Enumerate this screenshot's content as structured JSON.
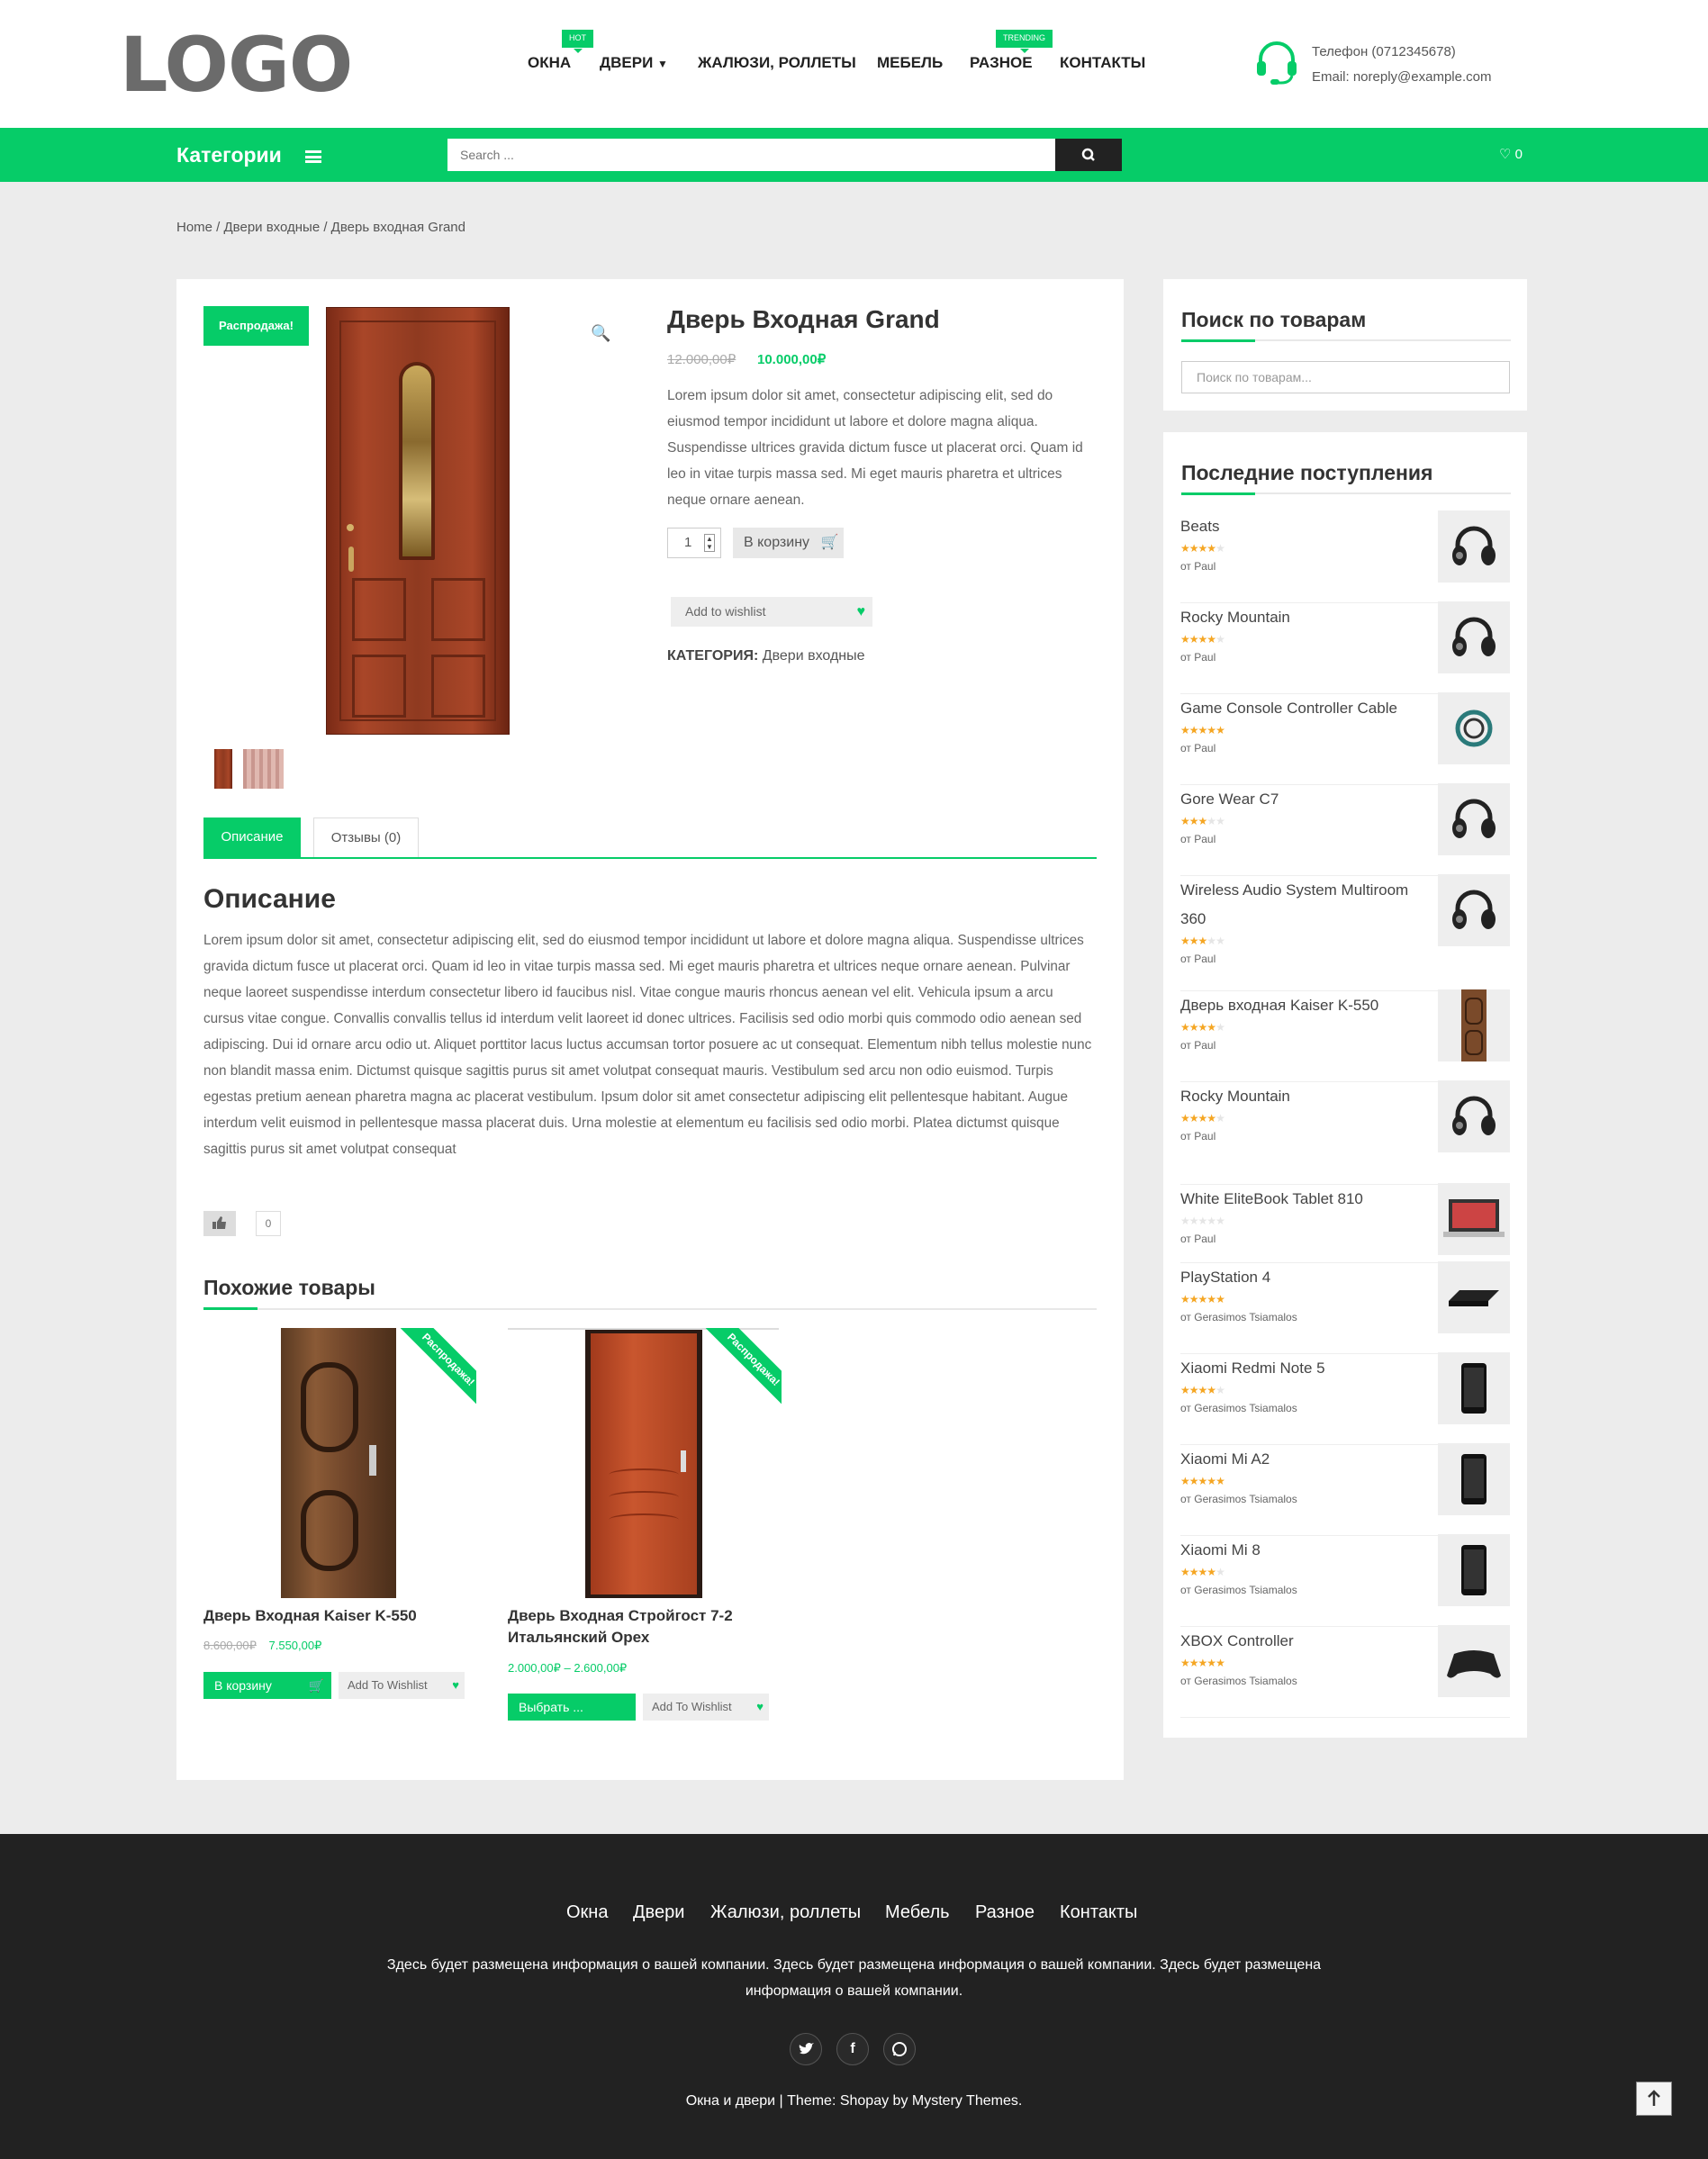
{
  "header": {
    "logo": "LOGO",
    "nav": [
      {
        "label": "ОКНА"
      },
      {
        "label": "ДВЕРИ",
        "badge": "HOT"
      },
      {
        "label": "ЖАЛЮЗИ, РОЛЛЕТЫ"
      },
      {
        "label": "МЕБЕЛЬ"
      },
      {
        "label": "РАЗНОЕ",
        "badge": "TRENDING"
      },
      {
        "label": "КОНТАКТЫ"
      }
    ],
    "phone": "Телефон (0712345678)",
    "email": "Email: noreply@example.com"
  },
  "catbar": {
    "categories_label": "Категории",
    "search_placeholder": "Search ...",
    "wishlist_count": "0"
  },
  "breadcrumb": "Home / Двери входные / Дверь входная Grand",
  "product": {
    "sale_badge": "Распродажа!",
    "title": "Дверь Входная Grand",
    "old_price": "12.000,00₽",
    "new_price": "10.000,00₽",
    "short_description": "Lorem ipsum dolor sit amet, consectetur adipiscing elit, sed do eiusmod tempor incididunt ut labore et dolore magna aliqua. Suspendisse ultrices gravida dictum fusce ut placerat orci. Quam id leo in vitae turpis massa sed. Mi eget mauris pharetra et ultrices neque ornare aenean.",
    "quantity": "1",
    "add_to_cart": "В корзину",
    "add_to_wishlist": "Add to wishlist",
    "category_label": "КАТЕГОРИЯ:",
    "category_value": "Двери входные"
  },
  "tabs": [
    {
      "label": "Описание"
    },
    {
      "label": "Отзывы (0)"
    }
  ],
  "description": {
    "heading": "Описание",
    "text": "Lorem ipsum dolor sit amet, consectetur adipiscing elit, sed do eiusmod tempor incididunt ut labore et dolore magna aliqua. Suspendisse ultrices gravida dictum fusce ut placerat orci. Quam id leo in vitae turpis massa sed. Mi eget mauris pharetra et ultrices neque ornare aenean. Pulvinar neque laoreet suspendisse interdum consectetur libero id faucibus nisl. Vitae congue mauris rhoncus aenean vel elit. Vehicula ipsum a arcu cursus vitae congue. Convallis convallis tellus id interdum velit laoreet id donec ultrices. Facilisis sed odio morbi quis commodo odio aenean sed adipiscing. Dui id ornare arcu odio ut. Aliquet porttitor lacus luctus accumsan tortor posuere ac ut consequat. Elementum nibh tellus molestie nunc non blandit massa enim. Dictumst quisque sagittis purus sit amet volutpat consequat mauris. Vestibulum sed arcu non odio euismod. Turpis egestas pretium aenean pharetra magna ac placerat vestibulum. Ipsum dolor sit amet consectetur adipiscing elit pellentesque habitant. Augue interdum velit euismod in pellentesque massa placerat duis. Urna molestie at elementum eu facilisis sed odio morbi. Platea dictumst quisque sagittis purus sit amet volutpat consequat",
    "like_count": "0"
  },
  "related": {
    "heading": "Похожие товары",
    "items": [
      {
        "ribbon": "Распродажа!",
        "title": "Дверь Входная Kaiser K-550",
        "old_price": "8.600,00₽",
        "price": "7.550,00₽",
        "button": "В корзину",
        "wishlist": "Add To Wishlist"
      },
      {
        "ribbon": "Распродажа!",
        "title": "Дверь Входная Стройгост 7-2 Итальянский Орех",
        "price_range": "2.000,00₽ – 2.600,00₽",
        "button": "Выбрать ...",
        "wishlist": "Add To Wishlist"
      }
    ]
  },
  "sidebar": {
    "search_title": "Поиск по товарам",
    "search_placeholder": "Поиск по товарам...",
    "latest_title": "Последние поступления",
    "products": [
      {
        "title": "Beats",
        "rating": 4,
        "by": "от Paul",
        "icon": "headphones-icon"
      },
      {
        "title": "Rocky Mountain",
        "rating": 4,
        "by": "от Paul",
        "icon": "headphones-icon"
      },
      {
        "title": "Game Console Controller Cable",
        "rating": 5,
        "by": "от Paul",
        "icon": "cable-icon"
      },
      {
        "title": "Gore Wear C7",
        "rating": 3,
        "by": "от Paul",
        "icon": "headphones-icon"
      },
      {
        "title": "Wireless Audio System Multiroom 360",
        "rating": 3,
        "by": "от Paul",
        "icon": "headphones-icon"
      },
      {
        "title": "Дверь входная Kaiser K-550",
        "rating": 4,
        "by": "от Paul",
        "icon": "door-icon"
      },
      {
        "title": "Rocky Mountain",
        "rating": 4,
        "by": "от Paul",
        "icon": "headphones-icon"
      },
      {
        "title": "White EliteBook Tablet 810",
        "rating": 0,
        "by": "от Paul",
        "icon": "laptop-icon"
      },
      {
        "title": "PlayStation 4",
        "rating": 5,
        "by": "от Gerasimos Tsiamalos",
        "icon": "console-icon"
      },
      {
        "title": "Xiaomi Redmi Note 5",
        "rating": 4,
        "by": "от Gerasimos Tsiamalos",
        "icon": "phone-icon"
      },
      {
        "title": "Xiaomi Mi A2",
        "rating": 5,
        "by": "от Gerasimos Tsiamalos",
        "icon": "phone-icon"
      },
      {
        "title": "Xiaomi Mi 8",
        "rating": 4,
        "by": "от Gerasimos Tsiamalos",
        "icon": "phone-icon"
      },
      {
        "title": "XBOX Controller",
        "rating": 5,
        "by": "от Gerasimos Tsiamalos",
        "icon": "gamepad-icon"
      }
    ]
  },
  "footer": {
    "nav": [
      "Окна",
      "Двери",
      "Жалюзи, роллеты",
      "Мебель",
      "Разное",
      "Контакты"
    ],
    "text": "Здесь будет размещена информация о вашей компании. Здесь будет размещена информация о вашей компании. Здесь будет размещена информация о вашей компании.",
    "social": [
      "twitter-icon",
      "facebook-icon",
      "whatsapp-icon"
    ],
    "copyright": "Окна и двери | Theme: Shopay by Mystery Themes."
  },
  "colors": {
    "accent": "#06cc68",
    "footer_bg": "#222222",
    "page_bg": "#ececec"
  }
}
